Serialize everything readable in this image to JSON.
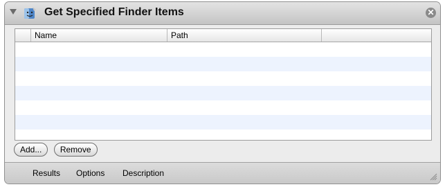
{
  "action": {
    "title": "Get Specified Finder Items",
    "close_symbol": "✕",
    "icons": {
      "disclosure": "disclosure-triangle-down",
      "app": "finder-icon",
      "close": "close-circle-icon"
    }
  },
  "table": {
    "columns": [
      "Name",
      "Path",
      ""
    ],
    "rows": []
  },
  "buttons": {
    "add_label": "Add...",
    "remove_label": "Remove"
  },
  "bottom_tabs": [
    "Results",
    "Options",
    "Description"
  ]
}
